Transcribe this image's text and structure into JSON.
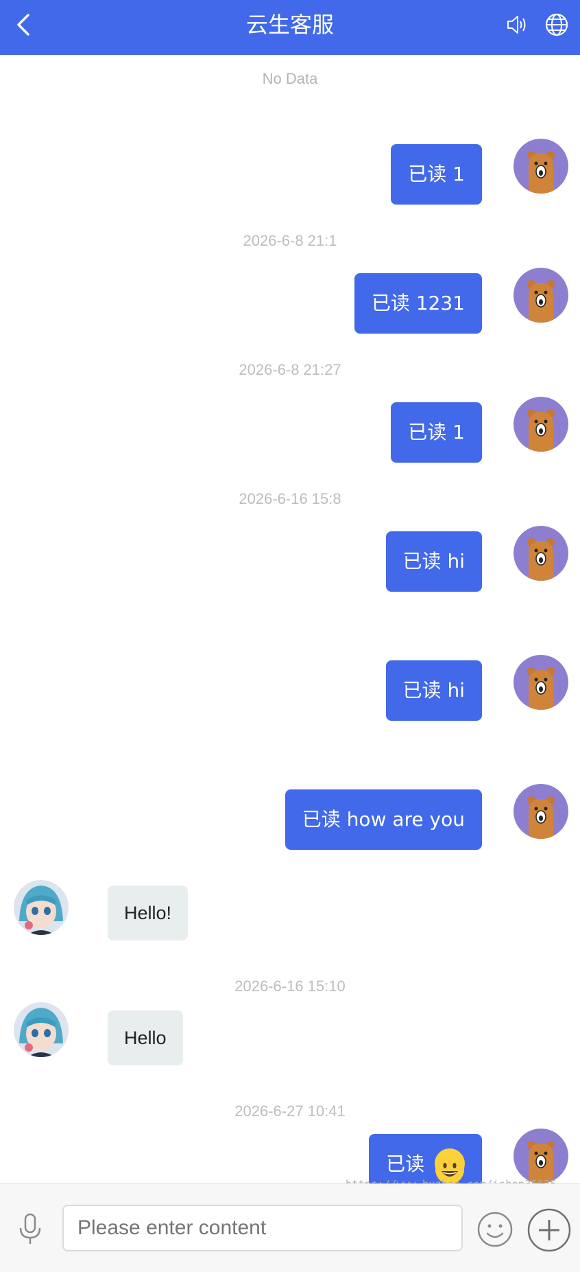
{
  "header": {
    "title": "云生客服",
    "icons": [
      "back-icon",
      "speaker-icon",
      "globe-icon"
    ],
    "background": "#4169e9"
  },
  "messages": {
    "no_data": "No Data",
    "timestamps": [
      "2026-6-8 21:1",
      "2026-6-8 21:27",
      "2026-6-16 15:8",
      "2026-6-16 15:10",
      "2026-6-27 10:41"
    ],
    "outgoing": [
      {
        "read": "已读",
        "text": "1"
      },
      {
        "read": "已读",
        "text": "1231"
      },
      {
        "read": "已读",
        "text": "1"
      },
      {
        "read": "已读",
        "text": "hi"
      },
      {
        "read": "已读",
        "text": "hi"
      },
      {
        "read": "已读",
        "text": "how are you"
      },
      {
        "read": "已读",
        "text": "",
        "emoji": "grinning-face-emoji"
      }
    ],
    "incoming": [
      {
        "text": "Hello!"
      },
      {
        "text": "Hello"
      }
    ],
    "outgoing_color": "#4169e9",
    "incoming_color": "#e8eeee"
  },
  "footer": {
    "input_placeholder": "Please enter content",
    "icons": [
      "microphone-icon",
      "emoji-icon",
      "plus-icon"
    ]
  },
  "watermark": "https://www.huzhan.com/ishop35675"
}
